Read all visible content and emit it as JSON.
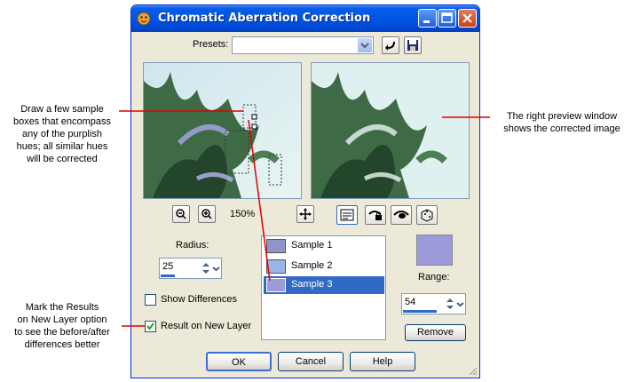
{
  "window": {
    "title": "Chromatic Aberration Correction"
  },
  "presets": {
    "label": "Presets:",
    "value": ""
  },
  "zoom": {
    "level": "150%"
  },
  "radius": {
    "label": "Radius:",
    "value": "25"
  },
  "samples": {
    "items": [
      {
        "label": "Sample 1",
        "color": "#8e95c8"
      },
      {
        "label": "Sample 2",
        "color": "#99b4e6"
      },
      {
        "label": "Sample 3",
        "color": "#9c9ad8"
      }
    ],
    "selected_index": 2
  },
  "range": {
    "label": "Range:",
    "value": "54",
    "swatch_color": "#9c9ad8"
  },
  "options": {
    "show_differences": {
      "label": "Show Differences",
      "checked": false
    },
    "result_on_new_layer": {
      "label": "Result on New Layer",
      "checked": true
    }
  },
  "buttons": {
    "ok": "OK",
    "cancel": "Cancel",
    "help": "Help",
    "remove": "Remove"
  },
  "annotations": {
    "left_top": [
      "Draw a few sample",
      "boxes that encompass",
      "any of the purplish",
      "hues; all similar hues",
      "will be corrected"
    ],
    "right": [
      "The right preview window",
      "shows the corrected image"
    ],
    "left_bottom": [
      "Mark the Results",
      "on New Layer option",
      "to see the before/after",
      "differences better"
    ]
  },
  "icons": [
    "app-icon",
    "minimize-icon",
    "maximize-icon",
    "close-icon",
    "reset-preset-icon",
    "save-preset-icon",
    "zoom-out-icon",
    "zoom-in-icon",
    "pan-icon",
    "proof-icon",
    "lock-icon",
    "eye-icon",
    "randomize-icon",
    "spin-arrows-icon",
    "dropdown-arrow-icon",
    "checkmark-icon",
    "resize-grip-icon"
  ]
}
